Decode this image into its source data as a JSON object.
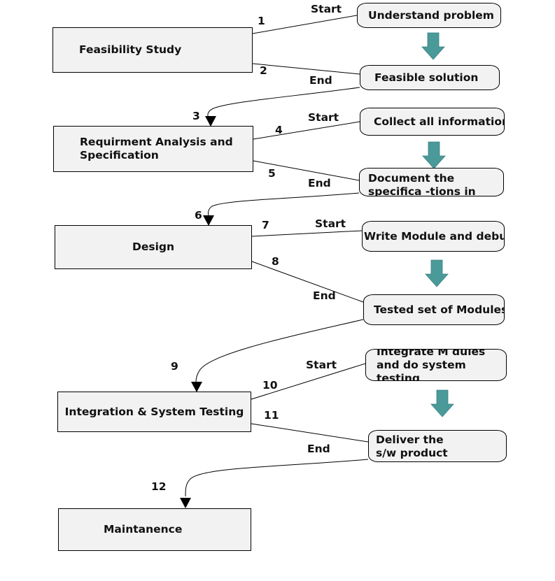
{
  "diagram": {
    "type": "waterfall-process-flow",
    "colors": {
      "box_fill": "#f2f2f2",
      "border": "#000000",
      "flow_arrow": "#4a9a9a"
    },
    "phases": [
      {
        "id": "feasibility",
        "label": "Feasibility Study"
      },
      {
        "id": "requirements",
        "label": "Requirment Analysis and Specification"
      },
      {
        "id": "design",
        "label": "Design"
      },
      {
        "id": "integration",
        "label": "Integration & System Testing"
      },
      {
        "id": "maintenance",
        "label": "Maintanence"
      }
    ],
    "tasks": [
      {
        "phase": "feasibility",
        "start_label": "Understand problem",
        "end_label": "Feasible solution"
      },
      {
        "phase": "requirements",
        "start_label": "Collect all information",
        "end_label": "Document the specifica -tions in SRS"
      },
      {
        "phase": "design",
        "start_label": "Write Module and debug",
        "end_label": "Tested set of Modules"
      },
      {
        "phase": "integration",
        "start_label": "Integrate M dules and do system testing",
        "end_label": "Deliver the s/w product"
      }
    ],
    "connector_labels": {
      "start": "Start",
      "end": "End"
    },
    "step_numbers": [
      "1",
      "2",
      "3",
      "4",
      "5",
      "6",
      "7",
      "8",
      "9",
      "10",
      "11",
      "12"
    ]
  }
}
